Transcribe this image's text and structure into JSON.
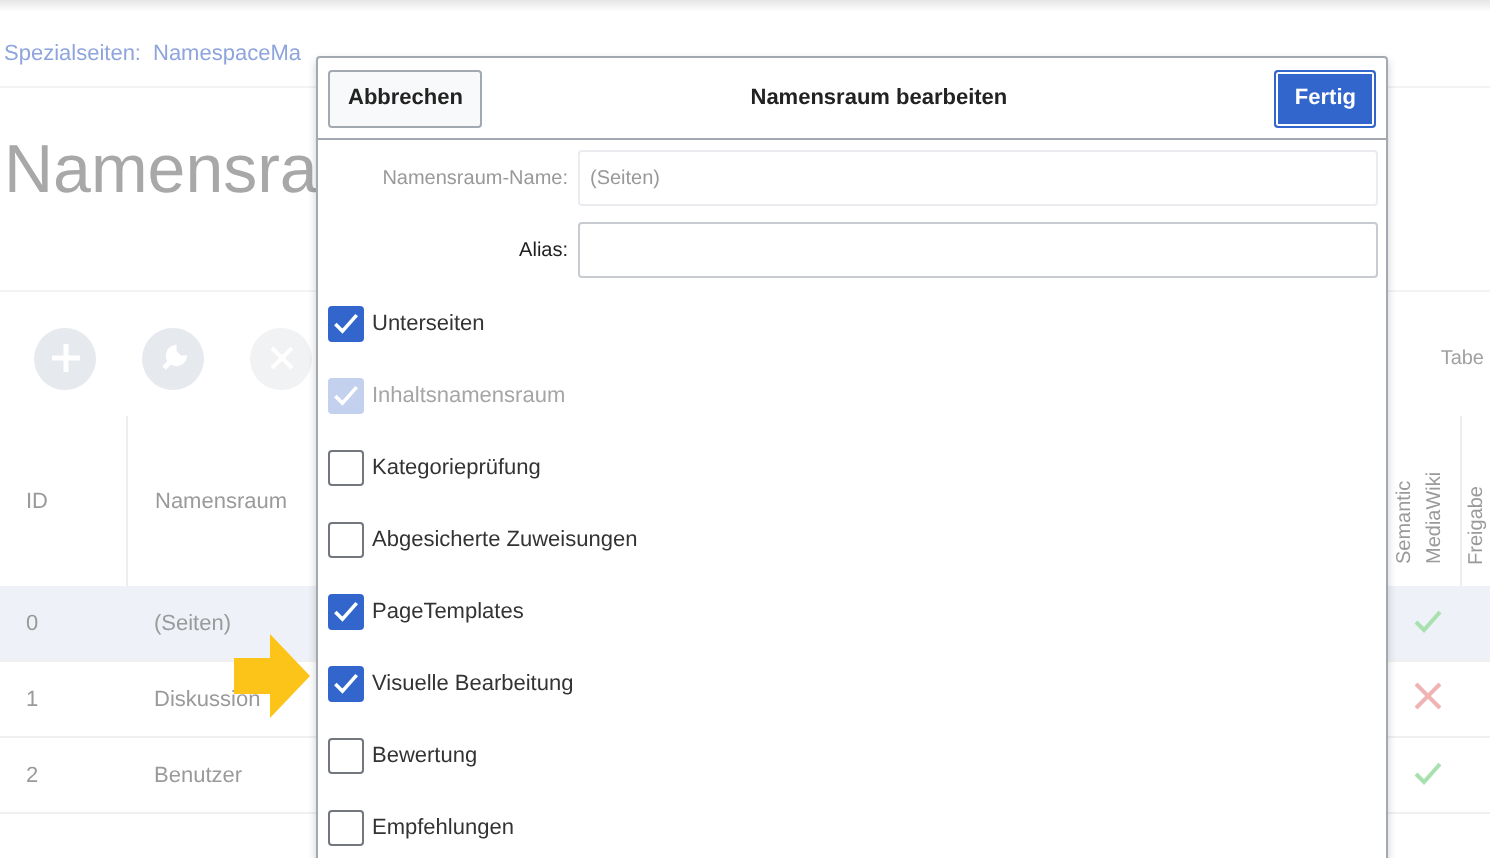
{
  "breadcrumb": {
    "label": "Spezialseiten:",
    "link": "NamespaceMa"
  },
  "heading": "Namensra",
  "toolbar": [
    {
      "kind": "add"
    },
    {
      "kind": "edit"
    },
    {
      "kind": "delete"
    }
  ],
  "table_label": "Tabe",
  "table": {
    "columns": [
      "ID",
      "Namensraum",
      "Semantic MediaWiki",
      "Freigabe"
    ],
    "rows": [
      {
        "id": "0",
        "name": "(Seiten)",
        "selected": true,
        "semantic": true
      },
      {
        "id": "1",
        "name": "Diskussion",
        "selected": false,
        "semantic": false
      },
      {
        "id": "2",
        "name": "Benutzer",
        "selected": false,
        "semantic": true
      }
    ]
  },
  "dialog": {
    "title": "Namensraum bearbeiten",
    "cancel": "Abbrechen",
    "done": "Fertig",
    "fields": [
      {
        "label": "Namensraum-Name:",
        "placeholder": "(Seiten)",
        "disabled": true
      },
      {
        "label": "Alias:",
        "disabled": false
      }
    ],
    "options": [
      {
        "label": "Unterseiten",
        "checked": true,
        "disabled": false
      },
      {
        "label": "Inhaltsnamensraum",
        "checked": true,
        "disabled": true
      },
      {
        "label": "Kategorieprüfung",
        "checked": false,
        "disabled": false
      },
      {
        "label": "Abgesicherte Zuweisungen",
        "checked": false,
        "disabled": false
      },
      {
        "label": "PageTemplates",
        "checked": true,
        "disabled": false
      },
      {
        "label": "Visuelle Bearbeitung",
        "checked": true,
        "disabled": false
      },
      {
        "label": "Bewertung",
        "checked": false,
        "disabled": false
      },
      {
        "label": "Empfehlungen",
        "checked": false,
        "disabled": false
      }
    ]
  }
}
